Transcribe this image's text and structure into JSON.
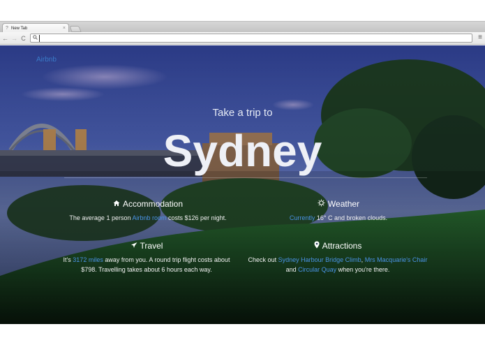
{
  "browser": {
    "tab_title": "New Tab",
    "tab_close": "×",
    "back": "←",
    "forward": "→",
    "reload": "C",
    "menu": "≡",
    "omnibox_value": ""
  },
  "page": {
    "corner_link": "Airbnb",
    "subtitle": "Take a trip to",
    "city": "Sydney",
    "accommodation": {
      "heading": "Accommodation",
      "text_before": "The average 1 person",
      "link": "Airbnb room",
      "text_after": "costs $126 per night."
    },
    "weather": {
      "heading": "Weather",
      "link": "Currently",
      "text_after": "16° C and broken clouds."
    },
    "travel": {
      "heading": "Travel",
      "text_before": "It's",
      "link": "3172 miles",
      "text_after": "away from you. A round trip flight costs about $798. Travelling takes about 6 hours each way."
    },
    "attractions": {
      "heading": "Attractions",
      "text_before": "Check out",
      "link1": "Sydney Harbour Bridge Climb",
      "sep1": ",",
      "link2": "Mrs Macquarie's Chair",
      "sep2": "and",
      "link3": "Circular Quay",
      "text_after": "when you're there."
    }
  },
  "icons": {
    "accommodation": "home-icon",
    "weather": "sun-icon",
    "travel": "plane-icon",
    "attractions": "map-marker-icon"
  },
  "colors": {
    "link": "#4a93e6",
    "sky_top": "#2b3f8a",
    "grass": "#1f5a2a"
  }
}
